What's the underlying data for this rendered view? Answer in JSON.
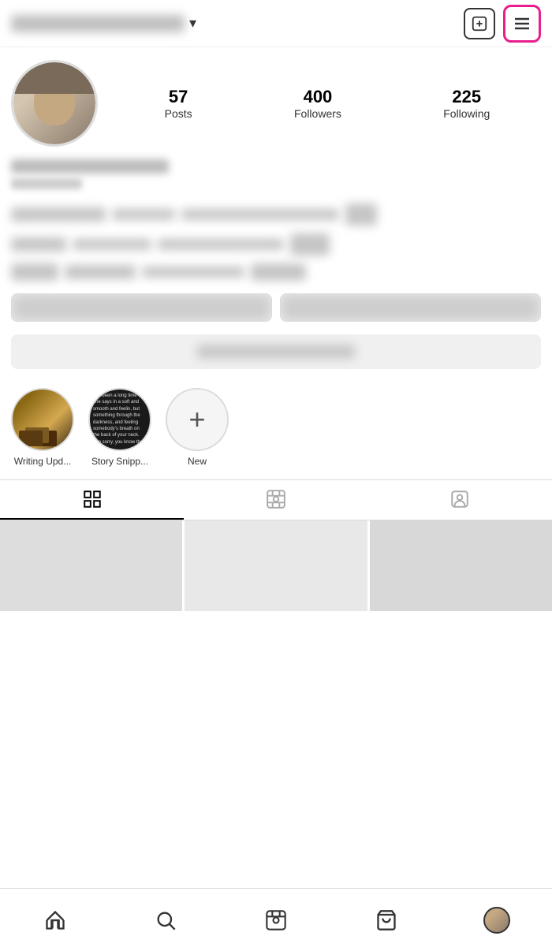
{
  "topBar": {
    "addLabel": "+",
    "chevron": "▾"
  },
  "profile": {
    "postsCount": "57",
    "postsLabel": "Posts",
    "followersCount": "400",
    "followersLabel": "Followers",
    "followingCount": "225",
    "followingLabel": "Following"
  },
  "highlights": [
    {
      "id": "writing",
      "label": "Writing Upd...",
      "type": "image1"
    },
    {
      "id": "snippets",
      "label": "Story Snipp...",
      "type": "image2"
    },
    {
      "id": "new",
      "label": "New",
      "type": "new"
    }
  ],
  "tabs": [
    {
      "id": "grid",
      "label": "Grid",
      "active": true
    },
    {
      "id": "reels",
      "label": "Reels",
      "active": false
    },
    {
      "id": "tagged",
      "label": "Tagged",
      "active": false
    }
  ],
  "bottomNav": [
    {
      "id": "home",
      "label": "Home"
    },
    {
      "id": "search",
      "label": "Search"
    },
    {
      "id": "reels",
      "label": "Reels"
    },
    {
      "id": "shop",
      "label": "Shop"
    },
    {
      "id": "profile",
      "label": "Profile"
    }
  ]
}
